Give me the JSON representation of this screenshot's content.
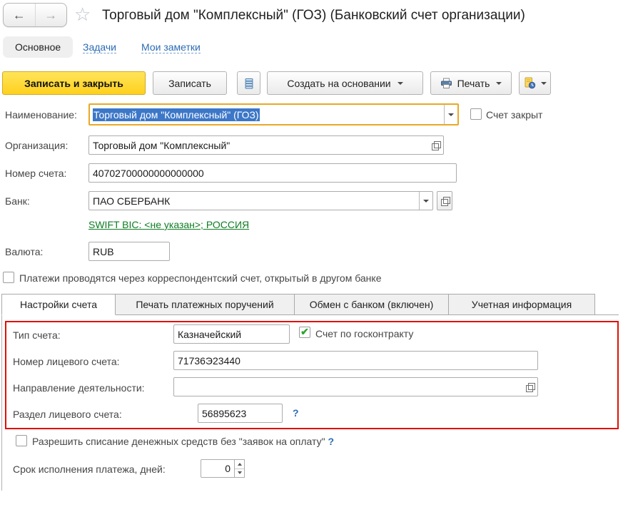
{
  "header": {
    "title": "Торговый дом \"Комплексный\" (ГОЗ) (Банковский счет организации)",
    "back_icon": "←",
    "forward_icon": "→",
    "star_icon": "☆"
  },
  "nav": {
    "active_item": "Основное",
    "links": [
      {
        "label": "Задачи"
      },
      {
        "label": "Мои заметки"
      }
    ]
  },
  "toolbar": {
    "save_and_close": "Записать и закрыть",
    "save": "Записать",
    "create_based_on": "Создать на основании",
    "print": "Печать"
  },
  "form": {
    "name_label": "Наименование:",
    "name_value": "Торговый дом \"Комплексный\" (ГОЗ)",
    "account_closed_label": "Счет закрыт",
    "organization_label": "Организация:",
    "organization_value": "Торговый дом \"Комплексный\"",
    "account_number_label": "Номер счета:",
    "account_number_value": "40702700000000000000",
    "bank_label": "Банк:",
    "bank_value": "ПАО СБЕРБАНК",
    "swift_link": "SWIFT BIC: <не указан>; РОССИЯ",
    "currency_label": "Валюта:",
    "currency_value": "RUB",
    "corr_account_label": "Платежи проводятся через корреспондентский счет, открытый в другом банке"
  },
  "tabs": [
    {
      "label": "Настройки счета",
      "active": true
    },
    {
      "label": "Печать платежных поручений",
      "active": false
    },
    {
      "label": "Обмен с банком (включен)",
      "active": false
    },
    {
      "label": "Учетная информация",
      "active": false
    }
  ],
  "settings": {
    "account_type_label": "Тип счета:",
    "account_type_value": "Казначейский",
    "gov_contract_label": "Счет по госконтракту",
    "gov_contract_check_icon": "✔",
    "personal_account_label": "Номер лицевого счета:",
    "personal_account_value": "71736Э23440",
    "activity_label": "Направление деятельности:",
    "activity_value": "",
    "section_label": "Раздел лицевого счета:",
    "section_value": "56895623",
    "section_help": "?",
    "writeoff_label": "Разрешить списание денежных средств без \"заявок на оплату\"",
    "writeoff_help": "?",
    "term_label": "Срок исполнения платежа, дней:",
    "term_value": "0"
  }
}
